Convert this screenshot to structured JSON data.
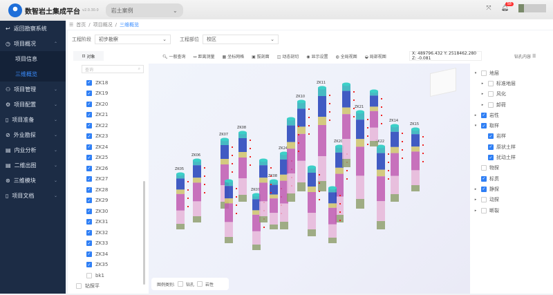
{
  "app": {
    "title": "数智岩土集成平台",
    "version": "v2.0.30.0",
    "project": "岩土案例",
    "notifications": "58"
  },
  "sidebar": {
    "back": "返回勘察系统",
    "items": [
      {
        "label": "项目概况",
        "subs": [
          "项目信息",
          "三维概览"
        ]
      },
      {
        "label": "项目管理"
      },
      {
        "label": "项目配置"
      },
      {
        "label": "项目准备"
      },
      {
        "label": "外业勘探"
      },
      {
        "label": "内业分析"
      },
      {
        "label": "二维出图"
      },
      {
        "label": "三维模块"
      },
      {
        "label": "项目文档"
      }
    ]
  },
  "breadcrumb": [
    "首页",
    "项目概况",
    "三维概览"
  ],
  "filters": {
    "stage_label": "工程阶段",
    "stage_value": "初步勘察",
    "part_label": "工程部位",
    "part_value": "校区"
  },
  "toolbar": {
    "object": "对象",
    "tools": [
      "一般查询",
      "距离测量",
      "坐标网格",
      "拔剖面",
      "动态剖切",
      "显示设置",
      "全局视图",
      "局部视图"
    ],
    "coord": "X: 489796.432 Y: 2518462.280 Z: -0.081",
    "drill_content": "钻孔内容"
  },
  "tree": {
    "search_placeholder": "查询",
    "items": [
      {
        "label": "ZK18",
        "checked": true
      },
      {
        "label": "ZK19",
        "checked": true
      },
      {
        "label": "ZK20",
        "checked": true
      },
      {
        "label": "ZK21",
        "checked": true
      },
      {
        "label": "ZK22",
        "checked": true
      },
      {
        "label": "ZK23",
        "checked": true
      },
      {
        "label": "ZK24",
        "checked": true
      },
      {
        "label": "ZK25",
        "checked": true
      },
      {
        "label": "ZK26",
        "checked": true
      },
      {
        "label": "ZK27",
        "checked": true
      },
      {
        "label": "ZK28",
        "checked": true
      },
      {
        "label": "ZK29",
        "checked": true
      },
      {
        "label": "ZK30",
        "checked": true
      },
      {
        "label": "ZK31",
        "checked": true
      },
      {
        "label": "ZK32",
        "checked": true
      },
      {
        "label": "ZK33",
        "checked": true
      },
      {
        "label": "ZK34",
        "checked": true
      },
      {
        "label": "ZK35",
        "checked": true
      },
      {
        "label": "bk1",
        "checked": false
      }
    ],
    "footer": "钻探平"
  },
  "legend": {
    "label": "图例类别:",
    "options": [
      "钻孔",
      "岩性"
    ]
  },
  "layers": [
    {
      "label": "地层",
      "checked": false,
      "caret": "▾",
      "indent": 0
    },
    {
      "label": "标准地层",
      "checked": false,
      "caret": "▸",
      "indent": 1
    },
    {
      "label": "风化",
      "checked": false,
      "caret": "▸",
      "indent": 1
    },
    {
      "label": "卸荷",
      "checked": false,
      "caret": "▸",
      "indent": 1
    },
    {
      "label": "岩性",
      "checked": true,
      "caret": "▸",
      "indent": 0
    },
    {
      "label": "取样",
      "checked": true,
      "caret": "▾",
      "indent": 0
    },
    {
      "label": "岩样",
      "checked": true,
      "caret": "",
      "indent": 1
    },
    {
      "label": "原状土样",
      "checked": true,
      "caret": "",
      "indent": 1
    },
    {
      "label": "扰动土样",
      "checked": true,
      "caret": "",
      "indent": 1
    },
    {
      "label": "物探",
      "checked": false,
      "caret": "",
      "indent": 0
    },
    {
      "label": "标贯",
      "checked": true,
      "caret": "",
      "indent": 0
    },
    {
      "label": "静探",
      "checked": true,
      "caret": "▸",
      "indent": 0
    },
    {
      "label": "动探",
      "checked": false,
      "caret": "▸",
      "indent": 0
    },
    {
      "label": "断裂",
      "checked": false,
      "caret": "▸",
      "indent": 0
    }
  ],
  "boreholes": [
    "ZK05",
    "ZK06",
    "ZK07",
    "ZK08",
    "ZK07",
    "ZK08",
    "ZK10",
    "ZK11",
    "ZK14",
    "ZK15",
    "ZK20",
    "ZK21",
    "ZK22",
    "ZK24"
  ]
}
